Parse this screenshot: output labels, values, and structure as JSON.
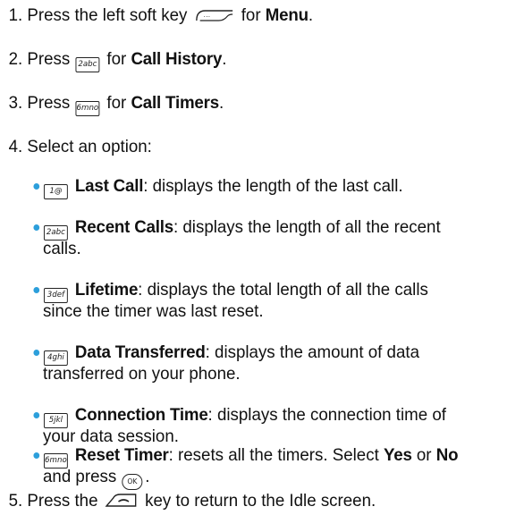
{
  "steps": [
    {
      "num": "1.",
      "pre": "Press the left soft key",
      "mid": "for",
      "bold": "Menu",
      "post": "."
    },
    {
      "num": "2.",
      "pre": "Press",
      "key": "2abc",
      "mid": "for",
      "bold": "Call History",
      "post": "."
    },
    {
      "num": "3.",
      "pre": "Press",
      "key": "6mno",
      "mid": "for",
      "bold": "Call Timers",
      "post": "."
    },
    {
      "num": "4.",
      "text": "Select an option:"
    },
    {
      "num": "5.",
      "pre": "Press the",
      "post": "key to return to the Idle screen."
    }
  ],
  "options": [
    {
      "key": "1@",
      "label": "Last Call",
      "desc_line1": ": displays the length of the last call.",
      "desc_line2": ""
    },
    {
      "key": "2abc",
      "label": "Recent Calls",
      "desc_line1": ": displays the length of all the recent",
      "desc_line2": "calls."
    },
    {
      "key": "3def",
      "label": "Lifetime",
      "desc_line1": ": displays the total length of all the calls",
      "desc_line2": "since the timer was last reset."
    },
    {
      "key": "4ghi",
      "label": "Data Transferred",
      "desc_line1": ": displays the amount of data",
      "desc_line2": "transferred on your phone."
    },
    {
      "key": "5jkl",
      "label": "Connection Time",
      "desc_line1": ": displays the connection time of",
      "desc_line2": "your data session."
    },
    {
      "key": "6mno",
      "label": "Reset Timer",
      "desc_line1": ": resets all the timers. Select",
      "yes": "Yes",
      "or": "or",
      "no": "No",
      "desc_line2": "and press"
    }
  ],
  "ok_key": "OK",
  "bullet_color": "#2c9fdb"
}
